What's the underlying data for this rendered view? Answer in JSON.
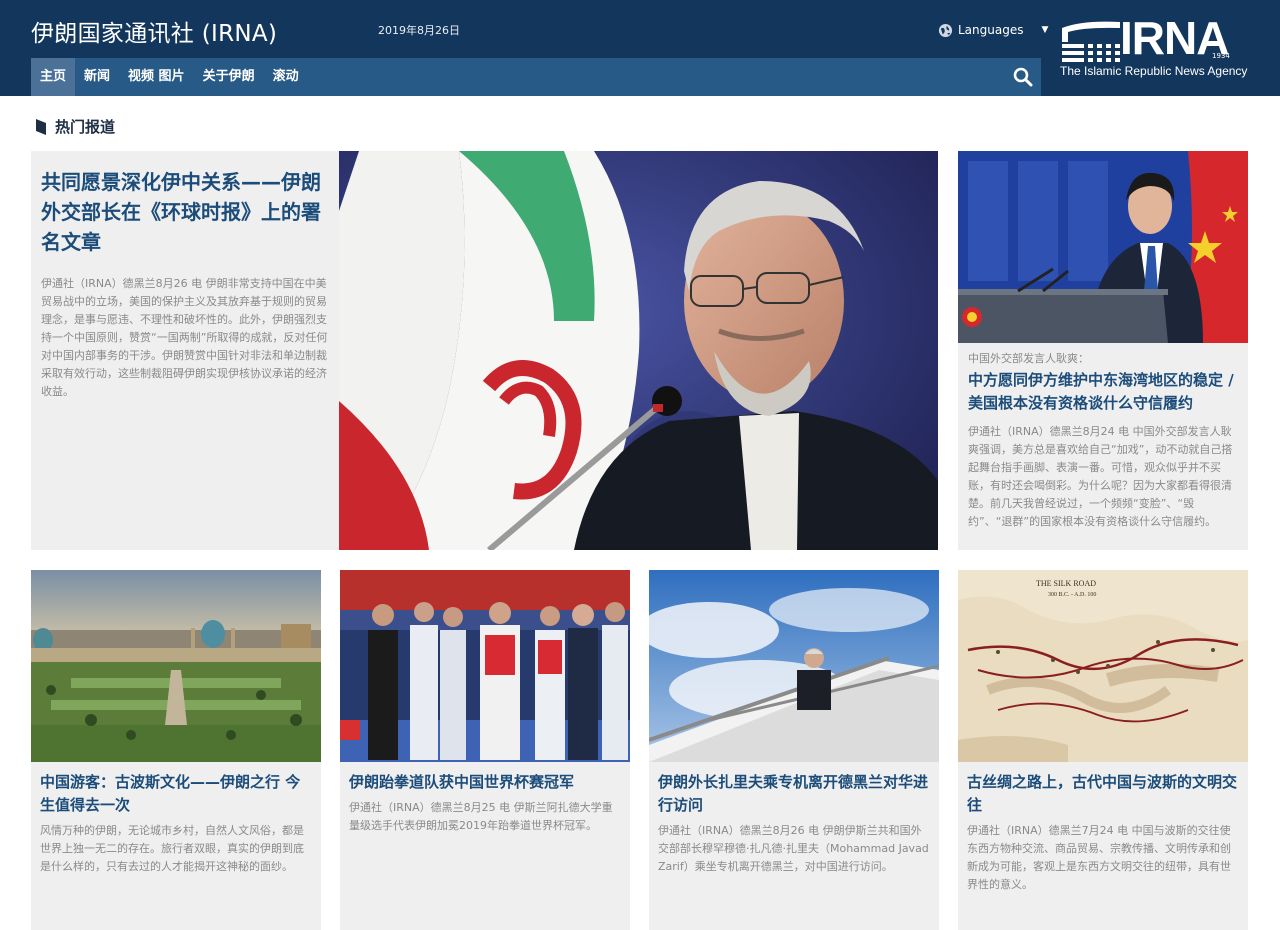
{
  "header": {
    "site_title": "伊朗国家通讯社 (IRNA)",
    "date": "2019年8月26日",
    "languages_label": "Languages",
    "logo": {
      "wordmark": "IRNA",
      "year": "1934",
      "subtitle": "The Islamic Republic News Agency"
    },
    "nav": [
      {
        "label": "主页",
        "active": true
      },
      {
        "label": "新闻",
        "active": false
      },
      {
        "label": "视频 图片",
        "active": false
      },
      {
        "label": "关于伊朗",
        "active": false
      },
      {
        "label": "滚动",
        "active": false
      }
    ],
    "search_icon": "search-icon",
    "globe_icon": "globe-icon"
  },
  "section": {
    "title": "热门报道"
  },
  "featured": {
    "title": "共同愿景深化伊中关系——伊朗外交部长在《环球时报》上的署名文章",
    "summary": "伊通社（IRNA）德黑兰8月26 电 伊朗非常支持中国在中美贸易战中的立场，美国的保护主义及其放弃基于规则的贸易理念，是事与愿违、不理性和破坏性的。此外，伊朗强烈支持一个中国原则，赞赏“一国两制”所取得的成就，反对任何对中国内部事务的干涉。伊朗赞赏中国针对非法和单边制裁采取有效行动，这些制裁阻碍伊朗实现伊核协议承诺的经济收益。"
  },
  "side_story": {
    "kicker": "中国外交部发言人耿爽：",
    "title": "中方愿同伊方维护中东海湾地区的稳定 / 美国根本没有资格谈什么守信履约",
    "summary": "伊通社（IRNA）德黑兰8月24 电 中国外交部发言人耿爽强调，美方总是喜欢给自己“加戏”，动不动就自己搭起舞台指手画脚、表演一番。可惜，观众似乎并不买账，有时还会喝倒彩。为什么呢？因为大家都看得很清楚。前几天我曾经说过，一个频频“变脸”、“毁约”、“退群”的国家根本没有资格谈什么守信履约。"
  },
  "stories": [
    {
      "title": "中国游客：古波斯文化——伊朗之行 今生值得去一次",
      "summary": "风情万种的伊朗，无论城市乡村，自然人文风俗，都是世界上独一无二的存在。旅行者双眼，真实的伊朗到底是什么样的，只有去过的人才能揭开这神秘的面纱。"
    },
    {
      "title": "伊朗跆拳道队获中国世界杯赛冠军",
      "summary": "伊通社（IRNA）德黑兰8月25 电 伊斯兰阿扎德大学重量级选手代表伊朗加冕2019年跆拳道世界杯冠军。"
    },
    {
      "title": "伊朗外长扎里夫乘专机离开德黑兰对华进行访问",
      "summary": "伊通社（IRNA）德黑兰8月26 电 伊朗伊斯兰共和国外交部部长穆罕穆德·扎凡德·扎里夫（Mohammad Javad Zarif）乘坐专机离开德黑兰，对中国进行访问。"
    },
    {
      "title": "古丝绸之路上，古代中国与波斯的文明交往",
      "summary": "伊通社（IRNA）德黑兰7月24 电 中国与波斯的交往使东西方物种交流、商品贸易、宗教传播、文明传承和创新成为可能，客观上是东西方文明交往的纽带，具有世界性的意义。"
    }
  ],
  "images": {
    "map_title": "THE SILK ROAD",
    "map_dates": "300 B.C. - A.D. 100"
  },
  "colors": {
    "header_bg": "#13375c",
    "nav_bg": "#285a87",
    "nav_active": "#4b7198",
    "title_blue": "#1c4d7a",
    "card_bg": "#efeff0"
  }
}
